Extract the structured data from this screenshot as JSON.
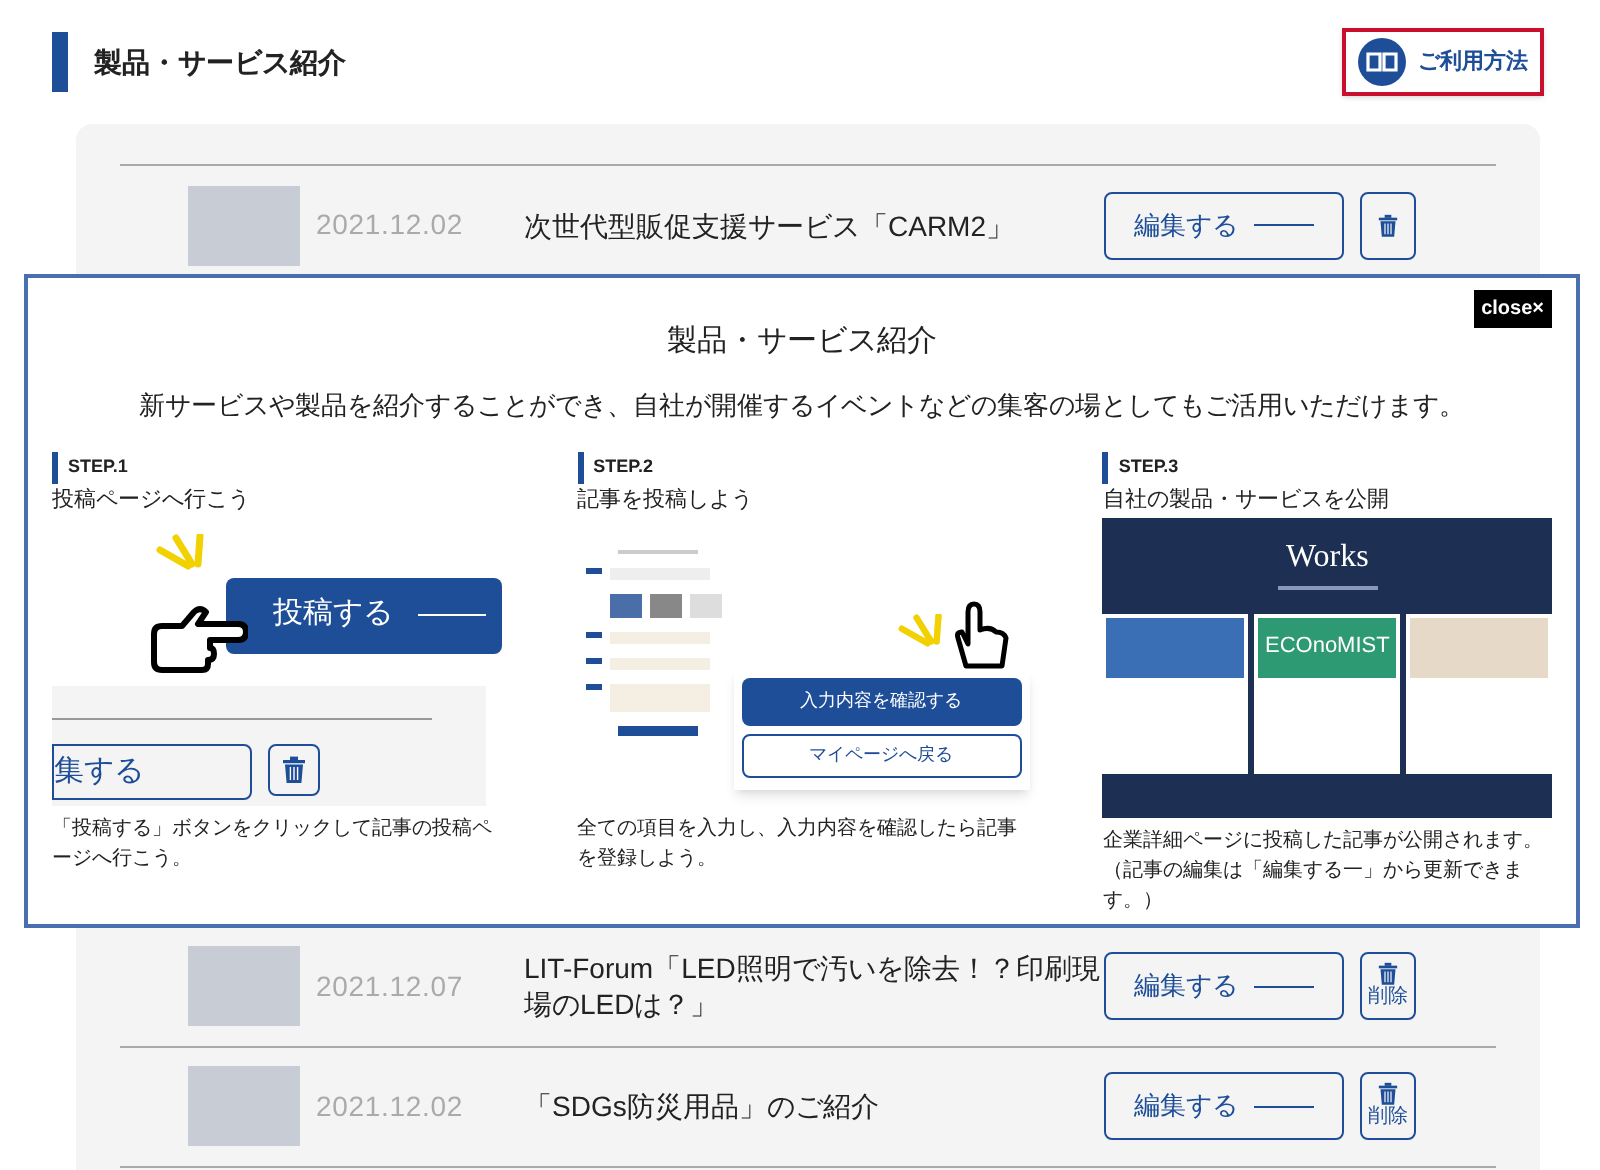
{
  "header": {
    "title": "製品・サービス紹介",
    "help_button": "ご利用方法"
  },
  "rows": [
    {
      "date": "2021.12.02",
      "title": "次世代型販促支援サービス「CARM2」",
      "edit": "編集する"
    },
    {
      "date": "2021.12.07",
      "title": "LIT-Forum「LED照明で汚いを除去！？印刷現場のLEDは？」",
      "edit": "編集する",
      "delete_label": "削除"
    },
    {
      "date": "2021.12.02",
      "title": "「SDGs防災用品」のご紹介",
      "edit": "編集する",
      "delete_label": "削除"
    }
  ],
  "modal": {
    "close": "close×",
    "title": "製品・サービス紹介",
    "description": "新サービスや製品を紹介することができ、自社が開催するイベントなどの集客の場としてもご活用いただけます。",
    "steps": [
      {
        "kind": "post",
        "step": "STEP.1",
        "heading": "投稿ページへ行こう",
        "caption": "「投稿する」ボタンをクリックして記事の投稿ページへ行こう。",
        "image_texts": [
          "投稿する",
          "集する"
        ]
      },
      {
        "kind": "form",
        "step": "STEP.2",
        "heading": "記事を投稿しよう",
        "caption": "全ての項目を入力し、入力内容を確認したら記事を登録しよう。",
        "image_texts": [
          "入力内容を確認する",
          "マイページへ戻る"
        ]
      },
      {
        "kind": "works",
        "step": "STEP.3",
        "heading": "自社の製品・サービスを公開",
        "caption": "企業詳細ページに投稿した記事が公開されます。（記事の編集は「編集する一」から更新できます。）",
        "image_texts": [
          "Works",
          "ECOnoMIST"
        ]
      }
    ]
  }
}
